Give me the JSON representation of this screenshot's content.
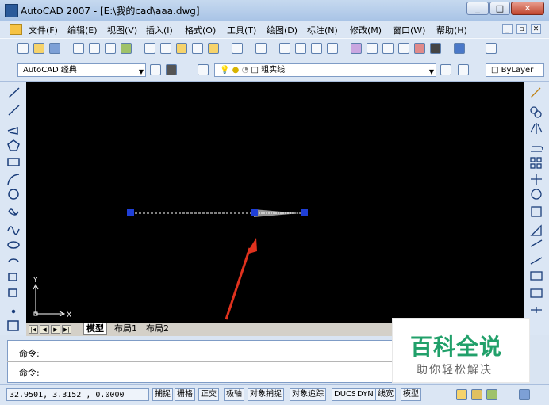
{
  "window": {
    "title": "AutoCAD 2007 - [E:\\我的cad\\aaa.dwg]",
    "minimize": "_",
    "maximize": "□",
    "close": "✕"
  },
  "menu": {
    "items": [
      "文件(F)",
      "编辑(E)",
      "视图(V)",
      "插入(I)",
      "格式(O)",
      "工具(T)",
      "绘图(D)",
      "标注(N)",
      "修改(M)",
      "窗口(W)",
      "帮助(H)"
    ],
    "doc_controls": [
      "_",
      "▫",
      "✕"
    ]
  },
  "workspace": {
    "selected": "AutoCAD 经典"
  },
  "layer": {
    "selected": "粗实线"
  },
  "color": {
    "selected": "ByLayer"
  },
  "canvas": {
    "ucs_x": "X",
    "ucs_y": "Y"
  },
  "tabs": {
    "nav": [
      "|◀",
      "◀",
      "▶",
      "▶|"
    ],
    "items": [
      "模型",
      "布局1",
      "布局2"
    ]
  },
  "command": {
    "line1": "命令:",
    "line2": "命令:"
  },
  "watermark": {
    "title": "百科全说",
    "subtitle": "助你轻松解决"
  },
  "status": {
    "coordinates": "32.9501, 3.3152 , 0.0000",
    "toggles": [
      "捕捉",
      "栅格",
      "正交",
      "极轴",
      "对象捕捉",
      "对象追踪",
      "DUCS",
      "DYN",
      "线宽",
      "模型"
    ]
  },
  "colors": {
    "canvas": "#000000",
    "grip": "#1f3fd6",
    "arrow": "#e0321e",
    "watermark": "#21a06a"
  }
}
